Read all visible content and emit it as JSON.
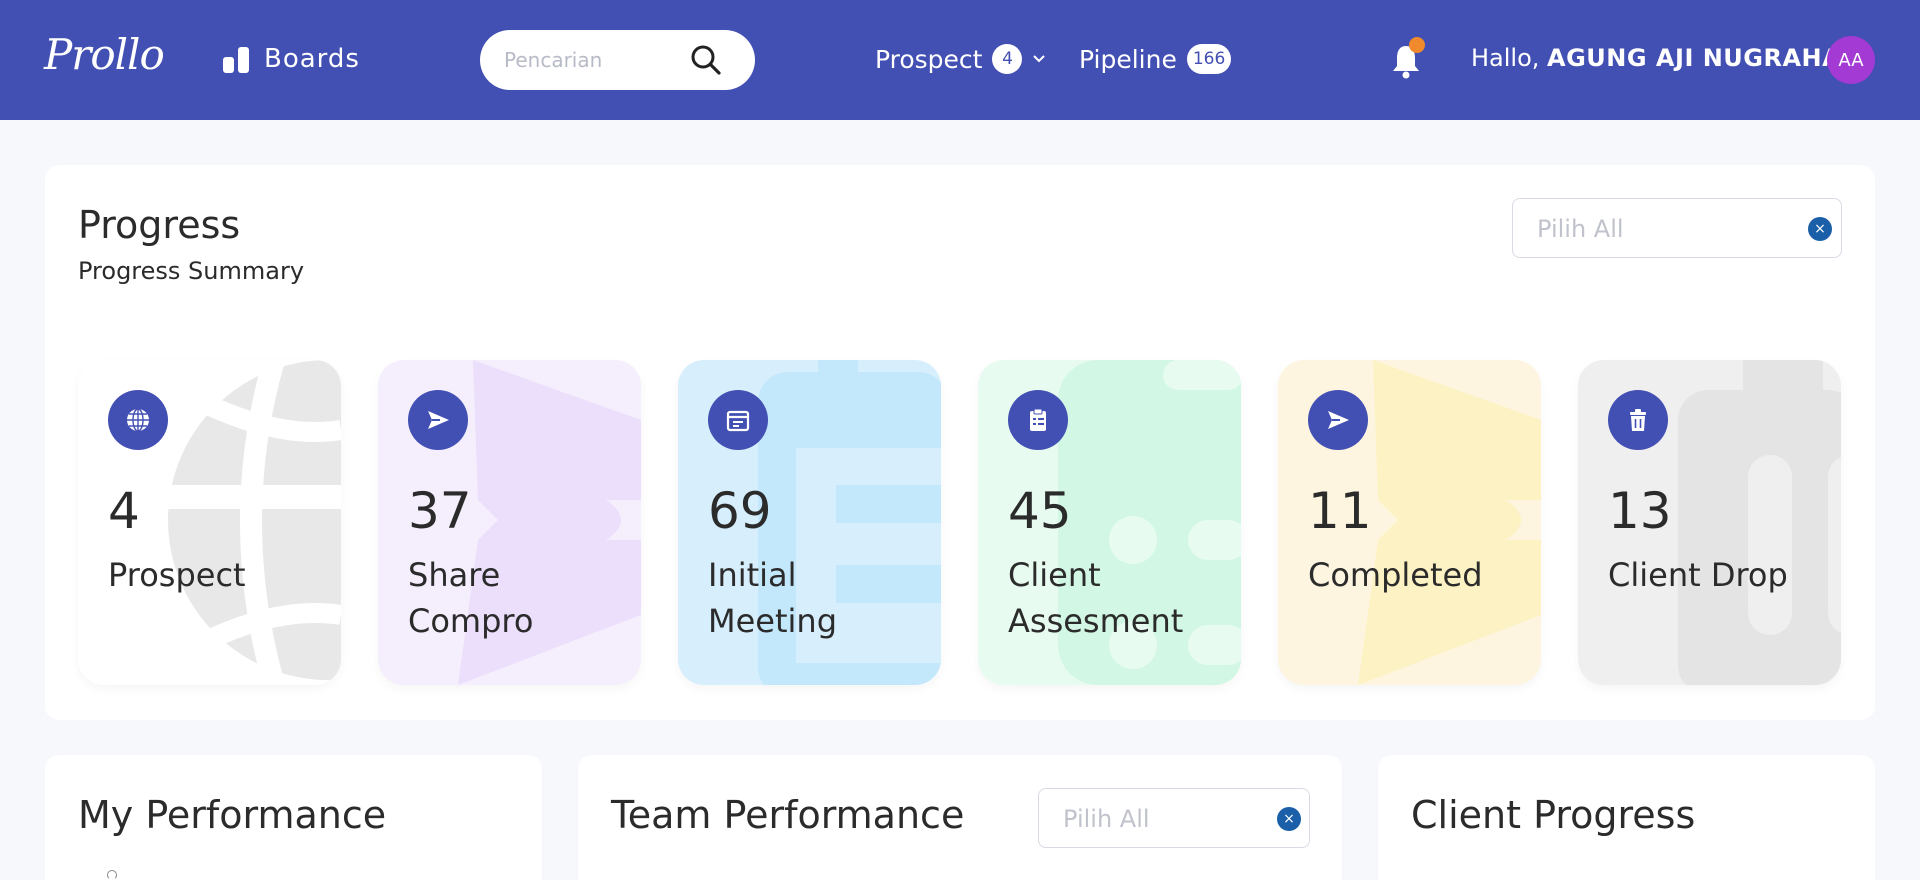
{
  "navbar": {
    "logo": "Prollo",
    "boards_label": "Boards",
    "search_placeholder": "Pencarian",
    "prospect_label": "Prospect",
    "prospect_count": "4",
    "pipeline_label": "Pipeline",
    "pipeline_count": "166",
    "greeting_prefix": "Hallo, ",
    "user_name": "AGUNG AJI NUGRAHA",
    "avatar_initials": "AA"
  },
  "progress": {
    "title": "Progress",
    "subtitle": "Progress Summary",
    "filter_placeholder": "Pilih All",
    "clear_symbol": "×",
    "cards": [
      {
        "count": "4",
        "label": "Prospect",
        "icon": "globe-icon",
        "bg": "#ffffff",
        "accent": "#e6e6e6"
      },
      {
        "count": "37",
        "label": "Share Compro",
        "icon": "send-icon",
        "bg": "#f5effd",
        "accent": "#ede1fb"
      },
      {
        "count": "69",
        "label": "Initial Meeting",
        "icon": "calendar-icon",
        "bg": "#d7effc",
        "accent": "#c6e8fa"
      },
      {
        "count": "45",
        "label": "Client Assesment",
        "icon": "clipboard-icon",
        "bg": "#e8fbf1",
        "accent": "#d2f7e4"
      },
      {
        "count": "11",
        "label": "Completed",
        "icon": "send-icon",
        "bg": "#fdf5e0",
        "accent": "#fdf2c3"
      },
      {
        "count": "13",
        "label": "Client Drop",
        "icon": "trash-icon",
        "bg": "#efefef",
        "accent": "#e6e6e6"
      }
    ]
  },
  "bottom": {
    "my_performance_title": "My Performance",
    "team_performance_title": "Team Performance",
    "team_filter_placeholder": "Pilih All",
    "client_progress_title": "Client Progress"
  },
  "colors": {
    "navbar": "#4350b3",
    "notification_dot": "#f08a2c",
    "avatar": "#a23ad3",
    "clear_button": "#1a5fa8"
  }
}
